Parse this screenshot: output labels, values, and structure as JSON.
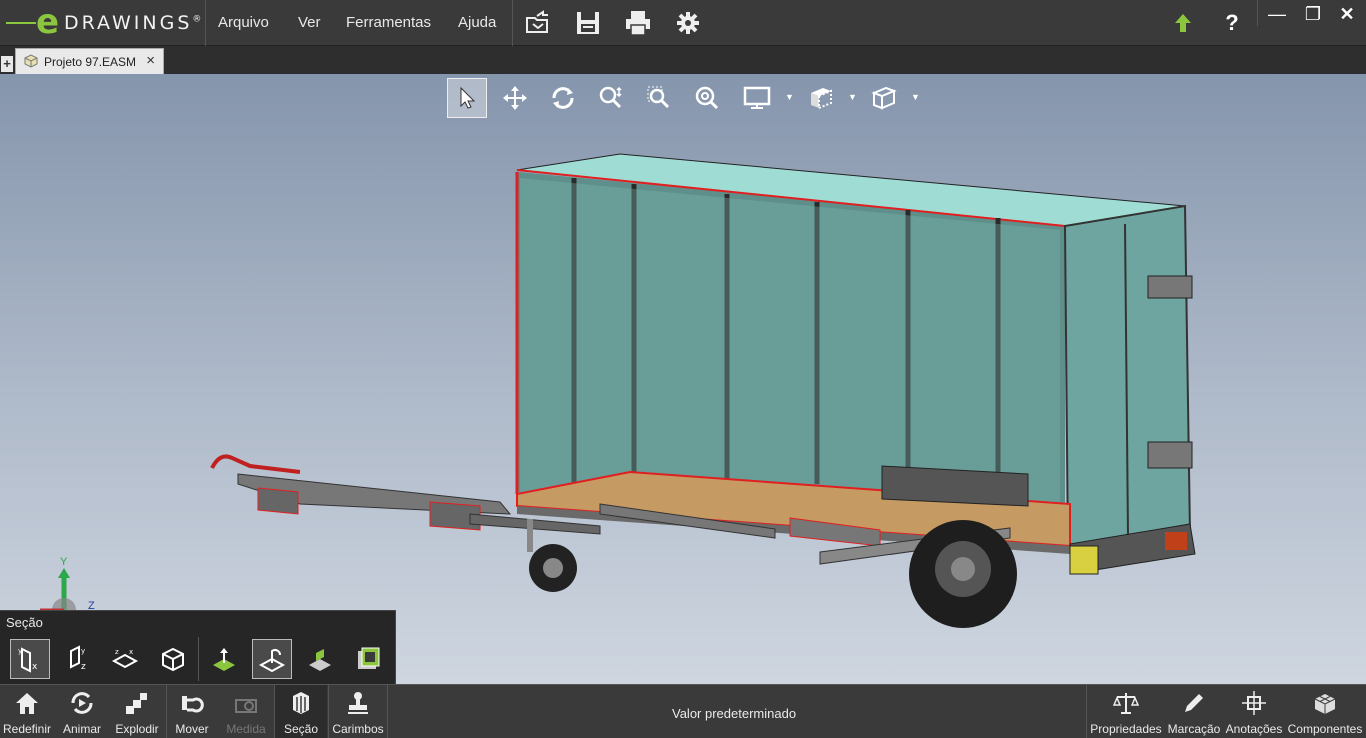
{
  "app": {
    "logo_letter": "e",
    "logo_word": "DRAWINGS",
    "logo_mark": "®"
  },
  "menu": {
    "items": [
      "Arquivo",
      "Ver",
      "Ferramentas",
      "Ajuda"
    ]
  },
  "toolbar_icons": [
    "open-icon",
    "save-icon",
    "print-icon",
    "settings-icon"
  ],
  "window_controls": {
    "help": "?",
    "minimize": "—",
    "restore": "❐",
    "close": "✕"
  },
  "tab": {
    "label": "Projeto 97.EASM",
    "add": "+",
    "close": "×"
  },
  "view_toolbar": {
    "tools": [
      "select-icon",
      "pan-icon",
      "rotate-icon",
      "zoom-icon",
      "zoom-area-icon",
      "zoom-fit-icon",
      "display-icon",
      "display-style-icon",
      "view-orientation-icon"
    ]
  },
  "triad": {
    "x": "",
    "y": "Y",
    "z": "Z"
  },
  "section_panel": {
    "title": "Seção",
    "buttons": [
      "section-x-icon",
      "section-z-icon",
      "section-zx-icon",
      "section-box-icon",
      "section-plane-icon",
      "section-flip-icon",
      "section-cap-icon",
      "section-display-icon"
    ]
  },
  "bottom_bar": {
    "left_buttons": [
      {
        "label": "Redefinir",
        "icon": "home-icon"
      },
      {
        "label": "Animar",
        "icon": "animate-icon"
      },
      {
        "label": "Explodir",
        "icon": "explode-icon"
      },
      {
        "label": "Mover",
        "icon": "move-icon"
      },
      {
        "label": "Medida",
        "icon": "measure-icon",
        "disabled": true
      },
      {
        "label": "Seção",
        "icon": "section-icon",
        "active": true
      },
      {
        "label": "Carimbos",
        "icon": "stamp-icon"
      }
    ],
    "status": "Valor predeterminado",
    "right_buttons": [
      {
        "label": "Propriedades",
        "icon": "scale-icon"
      },
      {
        "label": "Marcação",
        "icon": "pencil-icon"
      },
      {
        "label": "Anotações",
        "icon": "annotation-icon"
      },
      {
        "label": "Componentes",
        "icon": "components-icon"
      }
    ]
  },
  "colors": {
    "accent": "#8cc63f",
    "panel_fill": "#6fa5a0",
    "floor": "#c59a63",
    "section_edge": "#e02020"
  }
}
